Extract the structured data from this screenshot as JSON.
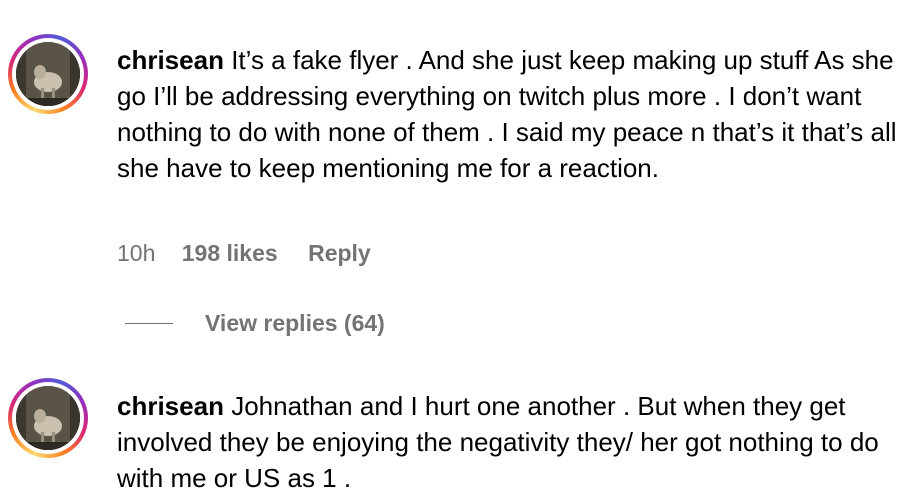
{
  "comments": [
    {
      "username": "chrisean",
      "text": "It’s a fake flyer . And she just keep making up stuff As she go I’ll be addressing everything on twitch plus more . I don’t want nothing to do with none of them . I said my peace n that’s it that’s all she have to keep mentioning me for a reaction.",
      "time": "10h",
      "likes": "198 likes",
      "reply_label": "Reply",
      "view_replies": "View replies (64)",
      "avatar_icon": "profile-photo"
    },
    {
      "username": "chrisean",
      "text": "Johnathan and I hurt one another . But when they get involved they be enjoying the negativity they/ her got nothing to do with me or US as 1 .",
      "avatar_icon": "profile-photo"
    }
  ],
  "colors": {
    "text": "#000000",
    "secondary_text": "#737373",
    "story_ring": [
      "#feda75",
      "#fa7e1e",
      "#d62976",
      "#962fbf",
      "#4f5bd5"
    ]
  }
}
